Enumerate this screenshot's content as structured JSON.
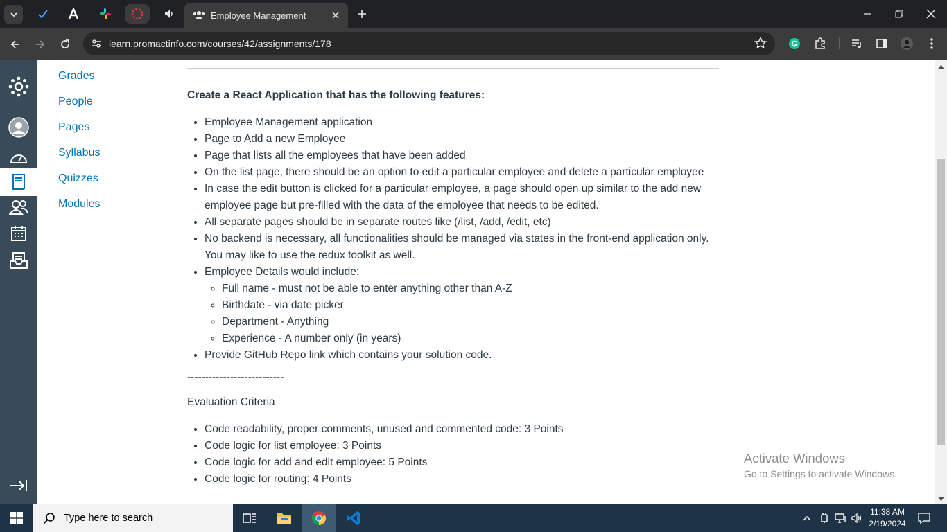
{
  "browser": {
    "active_tab_title": "Employee Management",
    "url": "learn.promactinfo.com/courses/42/assignments/178"
  },
  "course_nav": {
    "items": [
      "Grades",
      "People",
      "Pages",
      "Syllabus",
      "Quizzes",
      "Modules"
    ]
  },
  "assignment": {
    "heading": "Create a React Application that has the following features:",
    "features": [
      "Employee Management application",
      "Page to Add a new Employee",
      "Page that lists all the employees that have been added",
      "On the list page, there should be an option to edit a particular employee and delete a particular employee",
      "In case the edit button is clicked for a particular employee, a page should open up similar to the add new employee page but pre-filled with the data of the employee that needs to be edited.",
      "All separate pages should be in separate routes like (/list, /add, /edit, etc)",
      "No backend is necessary, all functionalities should be managed via states in the front-end application only. You may like to use the redux toolkit as well.",
      "Employee Details would include:"
    ],
    "employee_details": [
      "Full name - must not be able to enter anything other than A-Z",
      "Birthdate - via date picker",
      "Department - Anything",
      "Experience - A number only (in years)"
    ],
    "final_feature": "Provide GitHub Repo link which contains your solution code.",
    "separator": "---------------------------",
    "evaluation_heading": "Evaluation Criteria",
    "evaluation": [
      "Code readability, proper comments, unused and commented code: 3 Points",
      "Code logic for list employee: 3 Points",
      "Code logic for add and edit employee: 5 Points",
      "Code logic for routing: 4 Points"
    ]
  },
  "watermark": {
    "line1": "Activate Windows",
    "line2": "Go to Settings to activate Windows."
  },
  "taskbar": {
    "search_placeholder": "Type here to search",
    "time": "11:38 AM",
    "date": "2/19/2024"
  },
  "colors": {
    "link": "#0374b5",
    "global_nav": "#394b58",
    "text": "#2d3b45",
    "browser_dark": "#202124",
    "taskbar": "#1f3346"
  }
}
